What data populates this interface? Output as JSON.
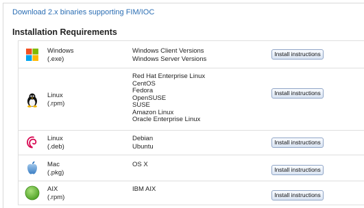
{
  "download_link": "Download 2.x binaries supporting FIM/IOC",
  "section_title": "Installation Requirements",
  "rows": [
    {
      "icon": "windows-logo-icon",
      "os": "Windows",
      "pkg": "(.exe)",
      "versions": [
        "Windows Client Versions",
        "Windows Server Versions"
      ],
      "button": "Install instructions"
    },
    {
      "icon": "linux-tux-icon",
      "os": "Linux",
      "pkg": "(.rpm)",
      "versions": [
        "Red Hat Enterprise Linux",
        "CentOS",
        "Fedora",
        "OpenSUSE",
        "SUSE",
        "Amazon Linux",
        "Oracle Enterprise Linux"
      ],
      "button": "Install instructions"
    },
    {
      "icon": "debian-swirl-icon",
      "os": "Linux",
      "pkg": "(.deb)",
      "versions": [
        "Debian",
        "Ubuntu"
      ],
      "button": "Install instructions"
    },
    {
      "icon": "apple-logo-icon",
      "os": "Mac",
      "pkg": "(.pkg)",
      "versions": [
        "OS X"
      ],
      "button": "Install instructions"
    },
    {
      "icon": "aix-logo-icon",
      "os": "AIX",
      "pkg": "(.rpm)",
      "versions": [
        "IBM AIX"
      ],
      "button": "Install instructions"
    }
  ],
  "colors": {
    "link": "#2a6db3",
    "button_border": "#8ea4c6",
    "windows_red": "#f25022",
    "windows_green": "#7fba00",
    "windows_blue": "#00a4ef",
    "windows_yellow": "#ffb900",
    "debian_red": "#d70751",
    "aix_green": "#5cb82e"
  }
}
